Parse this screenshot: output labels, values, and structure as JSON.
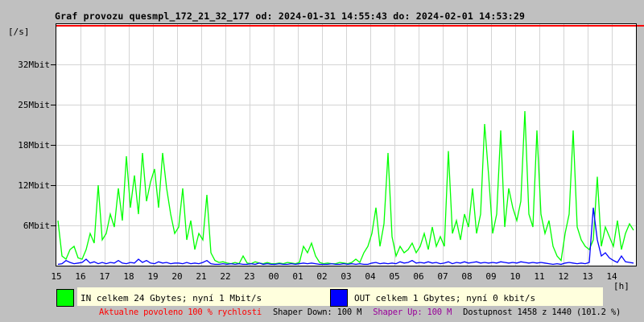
{
  "window": {
    "background": "#c0c0c0"
  },
  "chart_data": {
    "type": "line",
    "title": "Graf provozu quesmpl_172_21_32_177 od: 2024-01-31 14:55:43 do: 2024-02-01 14:53:29",
    "y_unit_label": "[/s]",
    "x_unit_label": "[h]",
    "ytick_labels": [
      "32Mbit",
      "25Mbit",
      "18Mbit",
      "12Mbit",
      "6Mbit"
    ],
    "ytick_values_mbit": [
      31.25,
      25,
      18.75,
      12.5,
      6.25
    ],
    "ylim_mbit": [
      0,
      37.5
    ],
    "x_hour_labels": [
      "15",
      "16",
      "17",
      "18",
      "19",
      "20",
      "21",
      "22",
      "23",
      "00",
      "01",
      "02",
      "03",
      "04",
      "05",
      "06",
      "07",
      "08",
      "09",
      "10",
      "11",
      "12",
      "13",
      "14"
    ],
    "samples_per_hour": 6,
    "grid": true,
    "grid_color": "#d4d4d4",
    "plot_background": "#ffffff",
    "limit_line": {
      "value_mbit": 37.3,
      "color": "#ff0000"
    },
    "series": [
      {
        "name": "IN",
        "color": "#00ff00",
        "unit": "Mbit/s",
        "values": [
          7,
          1.5,
          1,
          2.5,
          3,
          1.2,
          1,
          2.5,
          5,
          3.5,
          12.5,
          4,
          5,
          8,
          6,
          12,
          7,
          17,
          9,
          14,
          8,
          17.5,
          10,
          13,
          15,
          9,
          17.5,
          12,
          8,
          5,
          6,
          12,
          4,
          7,
          2.5,
          5,
          4,
          11,
          2,
          0.8,
          0.5,
          0.6,
          0.4,
          0.3,
          0.5,
          0.3,
          1.5,
          0.4,
          0.3,
          0.6,
          0.4,
          0.3,
          0.5,
          0.3,
          0.3,
          0.4,
          0.3,
          0.5,
          0.4,
          0.3,
          0.5,
          3,
          2,
          3.5,
          1.5,
          0.5,
          0.3,
          0.4,
          0.3,
          0.3,
          0.5,
          0.4,
          0.3,
          0.5,
          1,
          0.5,
          2,
          3,
          5,
          9,
          3,
          6.5,
          17.5,
          4.5,
          1.5,
          3,
          2,
          2.5,
          3.5,
          2,
          3,
          5,
          2.5,
          6,
          3,
          4.5,
          3,
          17.8,
          5,
          7,
          4,
          8,
          6,
          12,
          5,
          8,
          22,
          14,
          5,
          8,
          21,
          6,
          12,
          9,
          7,
          10,
          24,
          8,
          6,
          21,
          8,
          5,
          7,
          3,
          1.5,
          0.8,
          5,
          8,
          21,
          6,
          4,
          3,
          2.5,
          4,
          13.8,
          3,
          6,
          4.5,
          3,
          7,
          2.5,
          5,
          6.5,
          5.5
        ]
      },
      {
        "name": "OUT",
        "color": "#0000ff",
        "unit": "Mbit/s",
        "values": [
          0.2,
          0.3,
          0.8,
          0.5,
          0.3,
          0.4,
          0.5,
          1,
          0.4,
          0.6,
          0.3,
          0.5,
          0.3,
          0.5,
          0.4,
          0.8,
          0.4,
          0.3,
          0.5,
          0.4,
          1,
          0.5,
          0.8,
          0.4,
          0.3,
          0.6,
          0.4,
          0.5,
          0.3,
          0.4,
          0.4,
          0.3,
          0.5,
          0.3,
          0.4,
          0.3,
          0.5,
          0.8,
          0.3,
          0.2,
          0.2,
          0.3,
          0.2,
          0.3,
          0.2,
          0.3,
          0.2,
          0.2,
          0.3,
          0.2,
          0.4,
          0.2,
          0.3,
          0.2,
          0.2,
          0.3,
          0.2,
          0.2,
          0.3,
          0.2,
          0.3,
          0.4,
          0.3,
          0.4,
          0.3,
          0.2,
          0.2,
          0.2,
          0.3,
          0.2,
          0.2,
          0.3,
          0.2,
          0.3,
          0.2,
          0.3,
          0.2,
          0.2,
          0.4,
          0.5,
          0.3,
          0.4,
          0.3,
          0.4,
          0.3,
          0.6,
          0.4,
          0.5,
          0.8,
          0.4,
          0.5,
          0.4,
          0.6,
          0.4,
          0.5,
          0.3,
          0.4,
          0.6,
          0.3,
          0.5,
          0.4,
          0.6,
          0.4,
          0.5,
          0.6,
          0.4,
          0.5,
          0.4,
          0.5,
          0.4,
          0.6,
          0.5,
          0.4,
          0.5,
          0.4,
          0.6,
          0.5,
          0.4,
          0.5,
          0.4,
          0.5,
          0.4,
          0.3,
          0.2,
          0.3,
          0.2,
          0.4,
          0.5,
          0.4,
          0.3,
          0.4,
          0.3,
          0.5,
          9,
          4,
          1.5,
          2,
          1.2,
          0.8,
          0.5,
          1.5,
          0.6,
          0.5,
          0.4
        ]
      }
    ]
  },
  "legend": {
    "in_label": "IN celkem 24 Gbytes; nyní 1 Mbit/s",
    "out_label": "OUT celkem 1 Gbytes; nyní 0 kbit/s",
    "in_color": "#00ff00",
    "out_color": "#0000ff",
    "strip_color": "#ffffdd"
  },
  "status_bar": {
    "allowed": "Aktualne povoleno 100 % rychlosti",
    "shaper_down": "Shaper Down: 100 M",
    "shaper_up": "Shaper Up: 100 M",
    "availability": "Dostupnost 1458 z 1440 (101.2 %)",
    "allowed_color": "#ff0000",
    "shaper_up_color": "#990099"
  }
}
